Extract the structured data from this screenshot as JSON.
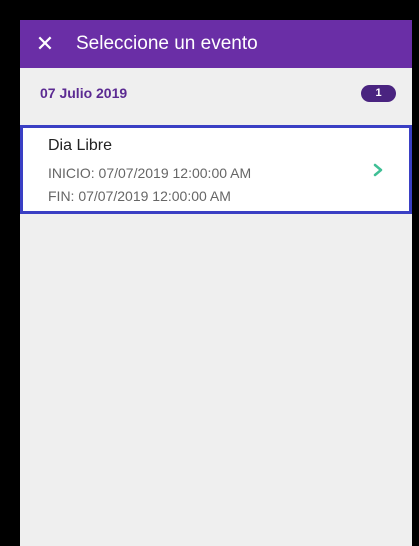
{
  "header": {
    "close_icon": "close-icon",
    "title": "Seleccione un evento",
    "color": "#6a2ea6"
  },
  "date_group": {
    "label": "07 Julio 2019",
    "count": "1"
  },
  "events": [
    {
      "title": "Dia Libre",
      "start": "INICIO: 07/07/2019 12:00:00 AM",
      "end": "FIN: 07/07/2019 12:00:00 AM",
      "chevron_icon": "chevron-right-icon",
      "chevron_color": "#3fbf95",
      "selected_border_color": "#3a3fc4"
    }
  ]
}
